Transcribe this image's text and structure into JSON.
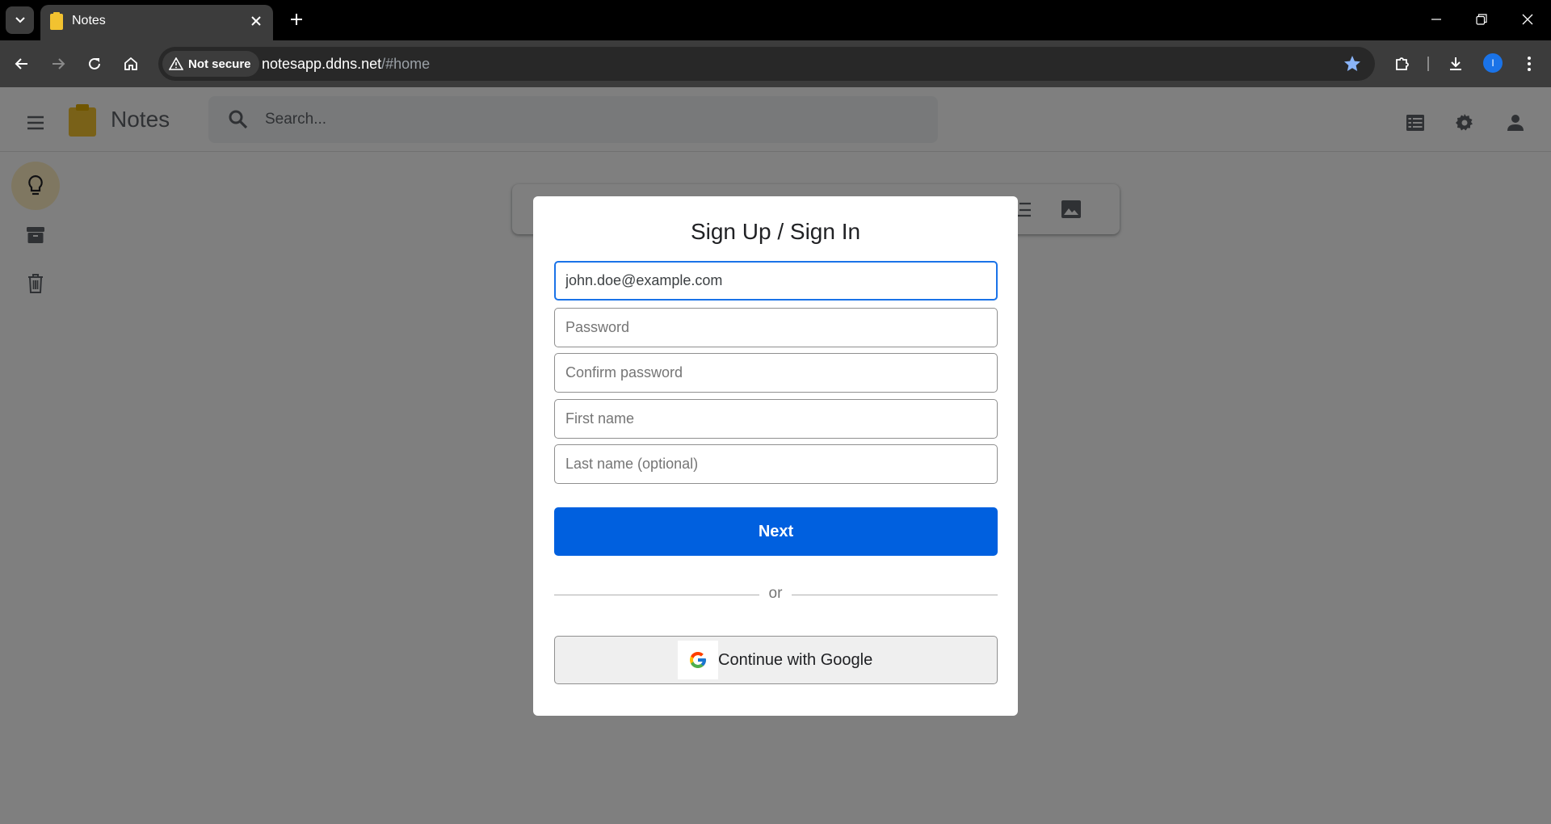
{
  "browser": {
    "tab_title": "Notes",
    "security_label": "Not secure",
    "url_host": "notesapp.ddns.net",
    "url_path": "/#home",
    "profile_initial": "I"
  },
  "app": {
    "name": "Notes",
    "search_placeholder": "Search...",
    "sidebar": [
      {
        "icon": "lightbulb-icon",
        "active": true
      },
      {
        "icon": "archive-icon",
        "active": false
      },
      {
        "icon": "trash-icon",
        "active": false
      }
    ]
  },
  "modal": {
    "title": "Sign Up / Sign In",
    "fields": {
      "email_value": "john.doe@example.com",
      "password_placeholder": "Password",
      "confirm_password_placeholder": "Confirm password",
      "first_name_placeholder": "First name",
      "last_name_placeholder": "Last name (optional)"
    },
    "next_label": "Next",
    "divider_text": "or",
    "google_label": "Continue with Google"
  },
  "colors": {
    "primary_button": "#0060df",
    "focus_border": "#1a73e8",
    "logo_yellow": "#f2c230"
  }
}
